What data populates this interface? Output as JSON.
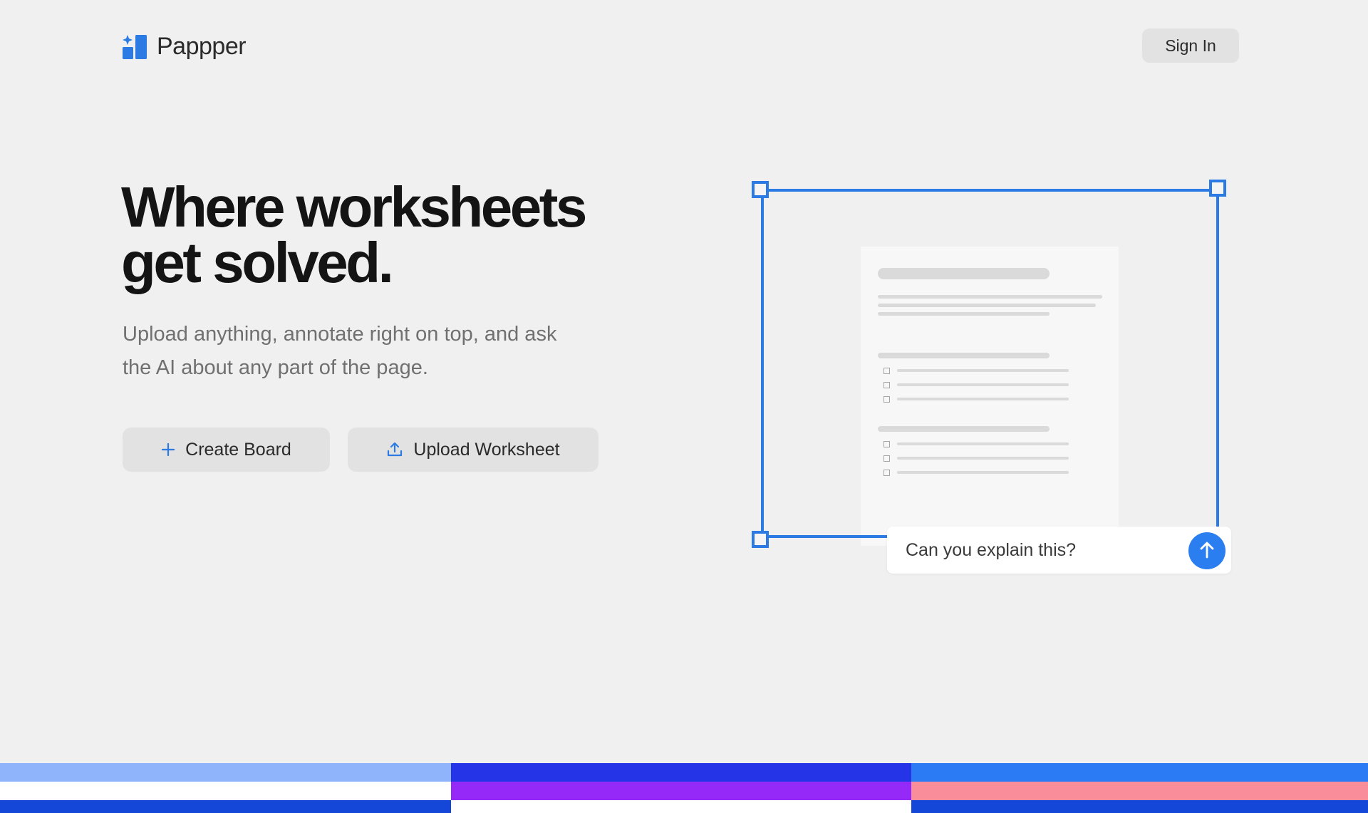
{
  "app": {
    "name": "Pappper"
  },
  "header": {
    "sign_in_label": "Sign In"
  },
  "hero": {
    "title_line1": "Where worksheets",
    "title_line2": "get solved.",
    "subtitle_line1": "Upload anything, annotate right on top, and ask",
    "subtitle_line2": "the AI about any part of the page."
  },
  "actions": {
    "create_board_label": "Create Board",
    "upload_worksheet_label": "Upload Worksheet"
  },
  "illustration": {
    "chat_prompt": "Can you explain this?"
  },
  "icons": {
    "logo": "pappper-logo-icon",
    "create": "plus-icon",
    "upload": "upload-icon",
    "send": "arrow-up-icon"
  },
  "colors": {
    "accent": "#2c7be5",
    "send_button": "#2a7ef0",
    "background": "#f0f0f0",
    "stripe_colors": [
      "#8fb4fb",
      "#ffffff",
      "#1447d7",
      "#2534e6",
      "#9529f7",
      "#ffffff",
      "#2b7cf4",
      "#fa8d9a",
      "#1447d7"
    ]
  }
}
